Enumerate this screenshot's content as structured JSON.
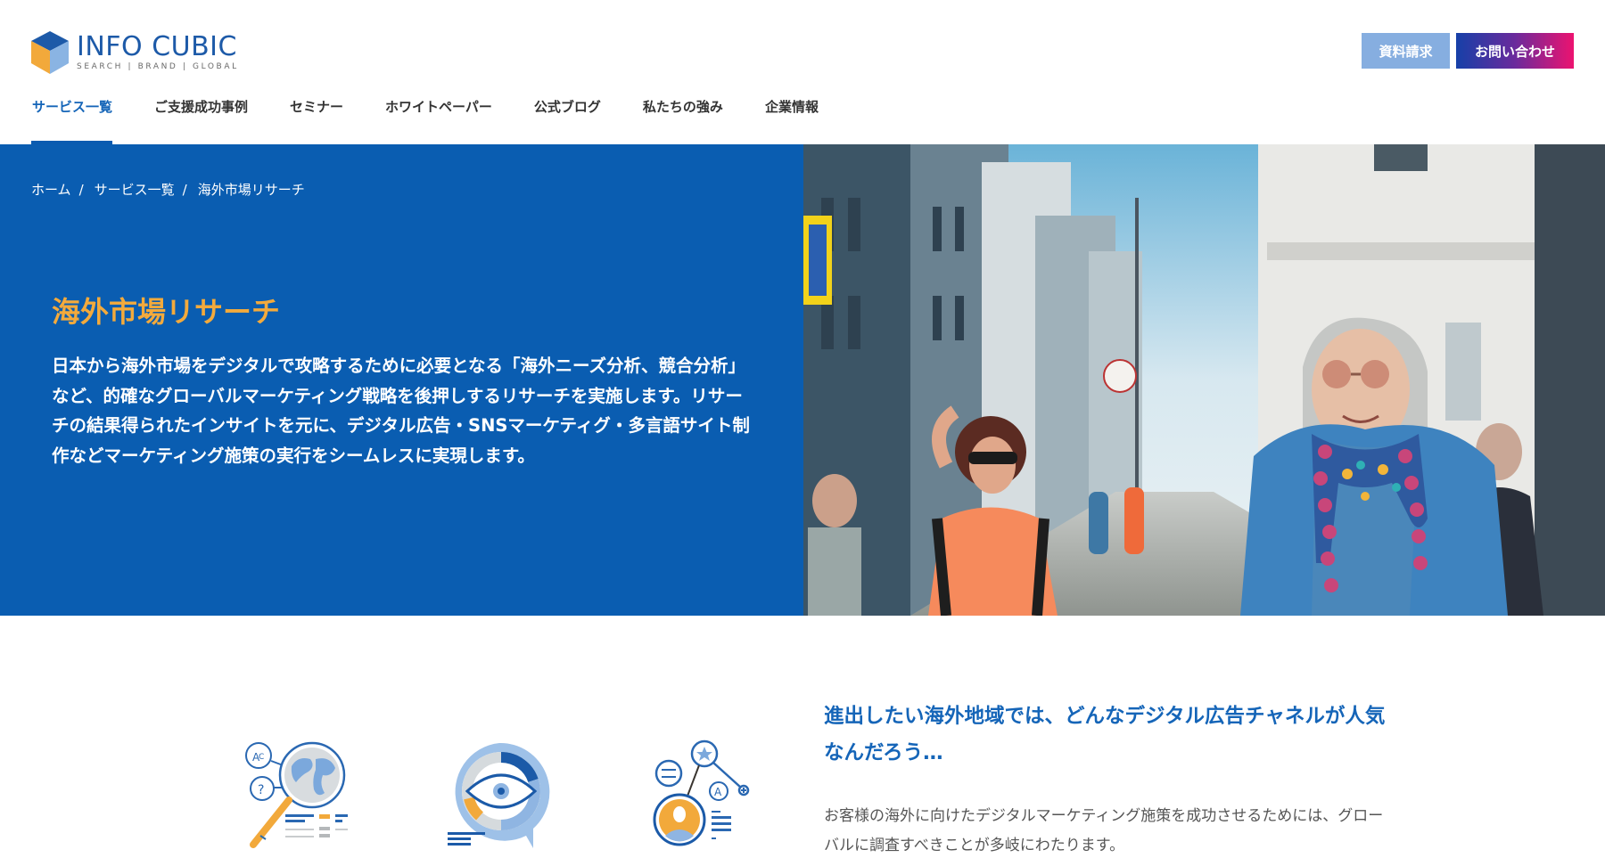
{
  "header": {
    "logo": {
      "name": "INFO CUBIC",
      "tagline": "SEARCH | BRAND | GLOBAL",
      "icon": "cube-logo-icon"
    },
    "buttons": {
      "document_request": "資料請求",
      "contact": "お問い合わせ"
    },
    "nav": [
      {
        "label": "サービス一覧",
        "active": true
      },
      {
        "label": "ご支援成功事例",
        "active": false
      },
      {
        "label": "セミナー",
        "active": false
      },
      {
        "label": "ホワイトペーパー",
        "active": false
      },
      {
        "label": "公式ブログ",
        "active": false
      },
      {
        "label": "私たちの強み",
        "active": false
      },
      {
        "label": "企業情報",
        "active": false
      }
    ]
  },
  "breadcrumb": {
    "items": [
      "ホーム",
      "サービス一覧",
      "海外市場リサーチ"
    ],
    "separator": "/"
  },
  "hero": {
    "title": "海外市場リサーチ",
    "description": "日本から海外市場をデジタルで攻略するために必要となる「海外ニーズ分析、競合分析」など、的確なグローバルマーケティング戦略を後押しするリサーチを実施します。リサーチの結果得られたインサイトを元に、デジタル広告・SNSマーケティグ・多言語サイト制作などマーケティング施策の実行をシームレスに実現します。",
    "image": "street-photo-women-walking"
  },
  "feature": {
    "icons": [
      "globe-magnifier-icon",
      "eye-chart-icon",
      "user-network-icon"
    ],
    "heading": "進出したい海外地域では、どんなデジタル広告チャネルが人気なんだろう…",
    "body": "お客様の海外に向けたデジタルマーケティング施策を成功させるためには、グローバルに調査すべきことが多岐にわたります。"
  },
  "colors": {
    "brand_blue": "#0a5db1",
    "accent_orange": "#f3aa3c",
    "heading_blue": "#1565b8",
    "doc_button": "#86aee0",
    "contact_gradient_start": "#1640a8",
    "contact_gradient_end": "#ec1370"
  }
}
